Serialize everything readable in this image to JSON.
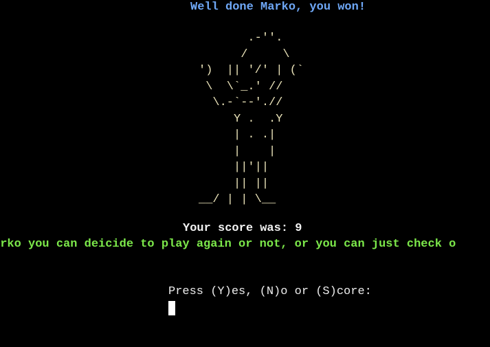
{
  "terminal": {
    "win_message": "Well done Marko, you won!",
    "trophy_art": "       .-''.\n      /     \\\n')  || '/' | (`\n \\  \\`_.' //\n  \\.-`--'.//\n     Y .  .Y\n     | . .|\n     |    |\n     ||'||\n     || ||\n__/ | | \\__",
    "score_label": "Your score was: ",
    "score_value": "9",
    "info_text": "arko you can deicide to play again or not, or you can just check o",
    "prompt_text": "Press (Y)es, (N)o or (S)core:"
  },
  "colors": {
    "background": "#000000",
    "win_message": "#6fa8f7",
    "trophy": "#e9e2b8",
    "score": "#f2f2f2",
    "info": "#7ce84a",
    "prompt": "#ececec",
    "cursor": "#ffffff"
  }
}
